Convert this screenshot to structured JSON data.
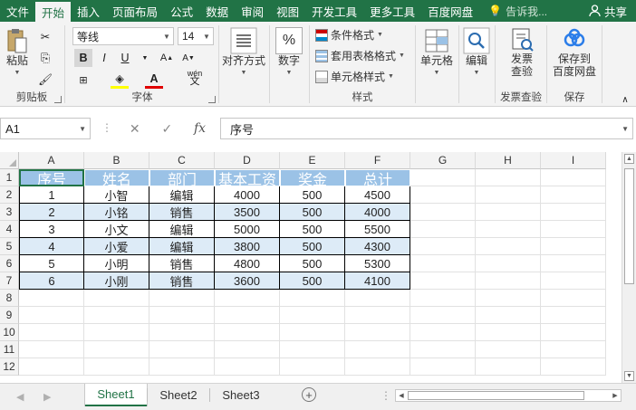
{
  "colors": {
    "accent": "#217346",
    "header_fill": "#9bc2e6",
    "band_fill": "#ddebf7"
  },
  "ribbon_tabs": [
    "文件",
    "开始",
    "插入",
    "页面布局",
    "公式",
    "数据",
    "审阅",
    "视图",
    "开发工具",
    "更多工具",
    "百度网盘"
  ],
  "active_tab": "开始",
  "tell_me": "告诉我...",
  "share": "共享",
  "clipboard": {
    "paste": "粘贴",
    "label": "剪贴板"
  },
  "font": {
    "name": "等线",
    "size": "14",
    "bold": "B",
    "italic": "I",
    "underline": "U",
    "wen": "wén",
    "label": "字体"
  },
  "alignment": {
    "label": "对齐方式"
  },
  "number": {
    "label": "数字",
    "percent": "%"
  },
  "styles": {
    "conditional": "条件格式",
    "table": "套用表格格式",
    "cell": "单元格样式",
    "label": "样式"
  },
  "cells": {
    "label": "单元格"
  },
  "editing": {
    "label": "编辑"
  },
  "invoice": {
    "button": "发票\n查验",
    "label": "发票查验"
  },
  "baidu": {
    "button": "保存到\n百度网盘",
    "label": "保存"
  },
  "name_box": "A1",
  "fx": "fx",
  "formula_value": "序号",
  "columns": [
    "A",
    "B",
    "C",
    "D",
    "E",
    "F",
    "G",
    "H",
    "I"
  ],
  "rows": [
    "1",
    "2",
    "3",
    "4",
    "5",
    "6",
    "7",
    "8",
    "9",
    "10",
    "11",
    "12"
  ],
  "table": {
    "headers": [
      "序号",
      "姓名",
      "部门",
      "基本工资",
      "奖金",
      "总计"
    ],
    "data": [
      [
        "1",
        "小智",
        "编辑",
        "4000",
        "500",
        "4500"
      ],
      [
        "2",
        "小铭",
        "销售",
        "3500",
        "500",
        "4000"
      ],
      [
        "3",
        "小文",
        "编辑",
        "5000",
        "500",
        "5500"
      ],
      [
        "4",
        "小爱",
        "编辑",
        "3800",
        "500",
        "4300"
      ],
      [
        "5",
        "小明",
        "销售",
        "4800",
        "500",
        "5300"
      ],
      [
        "6",
        "小刚",
        "销售",
        "3600",
        "500",
        "4100"
      ]
    ]
  },
  "sheets": [
    "Sheet1",
    "Sheet2",
    "Sheet3"
  ],
  "active_sheet": "Sheet1"
}
